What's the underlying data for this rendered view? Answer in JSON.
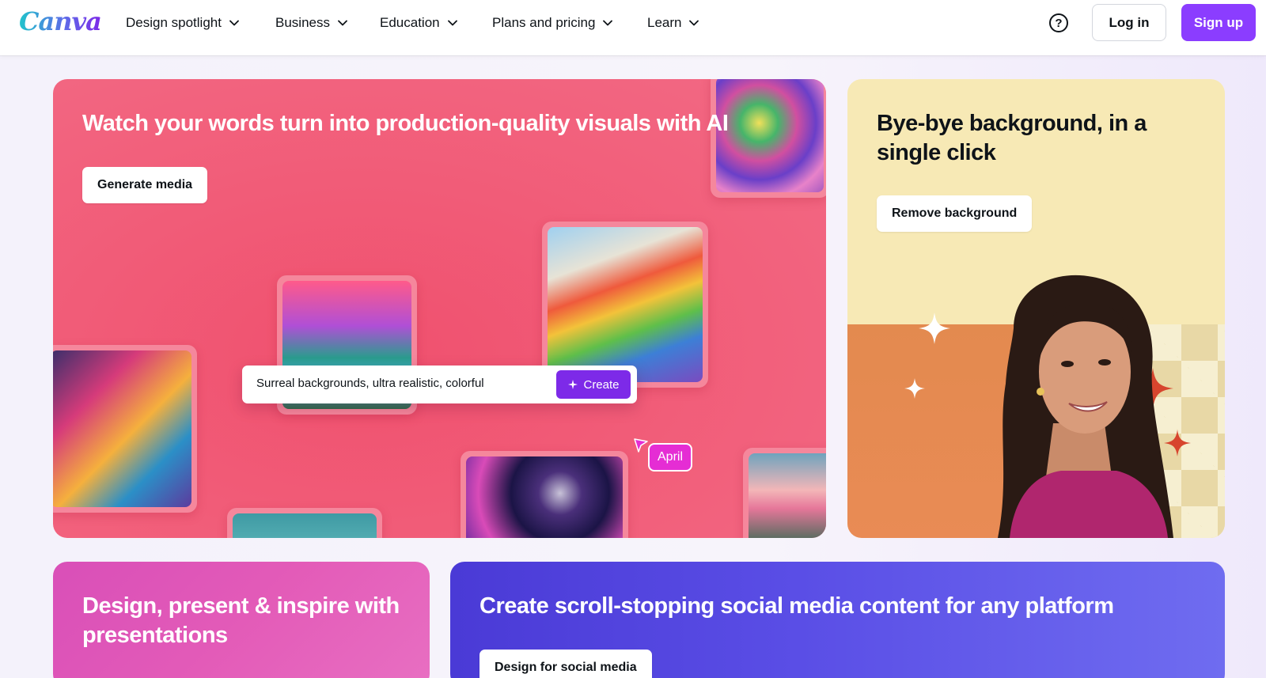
{
  "nav": {
    "logo": "Canva",
    "items": [
      {
        "label": "Design spotlight"
      },
      {
        "label": "Business"
      },
      {
        "label": "Education"
      },
      {
        "label": "Plans and pricing"
      },
      {
        "label": "Learn"
      }
    ],
    "help_label": "?",
    "login_label": "Log in",
    "signup_label": "Sign up"
  },
  "colors": {
    "brand_purple": "#8b3dff",
    "ai_card": "#f15c78",
    "bg_card": "#f7e9b5",
    "pres_card": "#e35bb8",
    "social_card": "#5a4ee6"
  },
  "ai_card": {
    "title": "Watch your words turn into production-quality visuals with AI",
    "button": "Generate media",
    "prompt": {
      "text": "Surreal backgrounds, ultra realistic, colorful",
      "create_label": "Create",
      "create_icon": "sparkle-icon"
    },
    "cursor_tag": "April"
  },
  "bg_card": {
    "title": "Bye-bye background, in a single click",
    "button": "Remove background"
  },
  "pres_card": {
    "title": "Design, present & inspire with presentations"
  },
  "social_card": {
    "title": "Create scroll-stopping social media content for any platform",
    "button": "Design for social media"
  }
}
